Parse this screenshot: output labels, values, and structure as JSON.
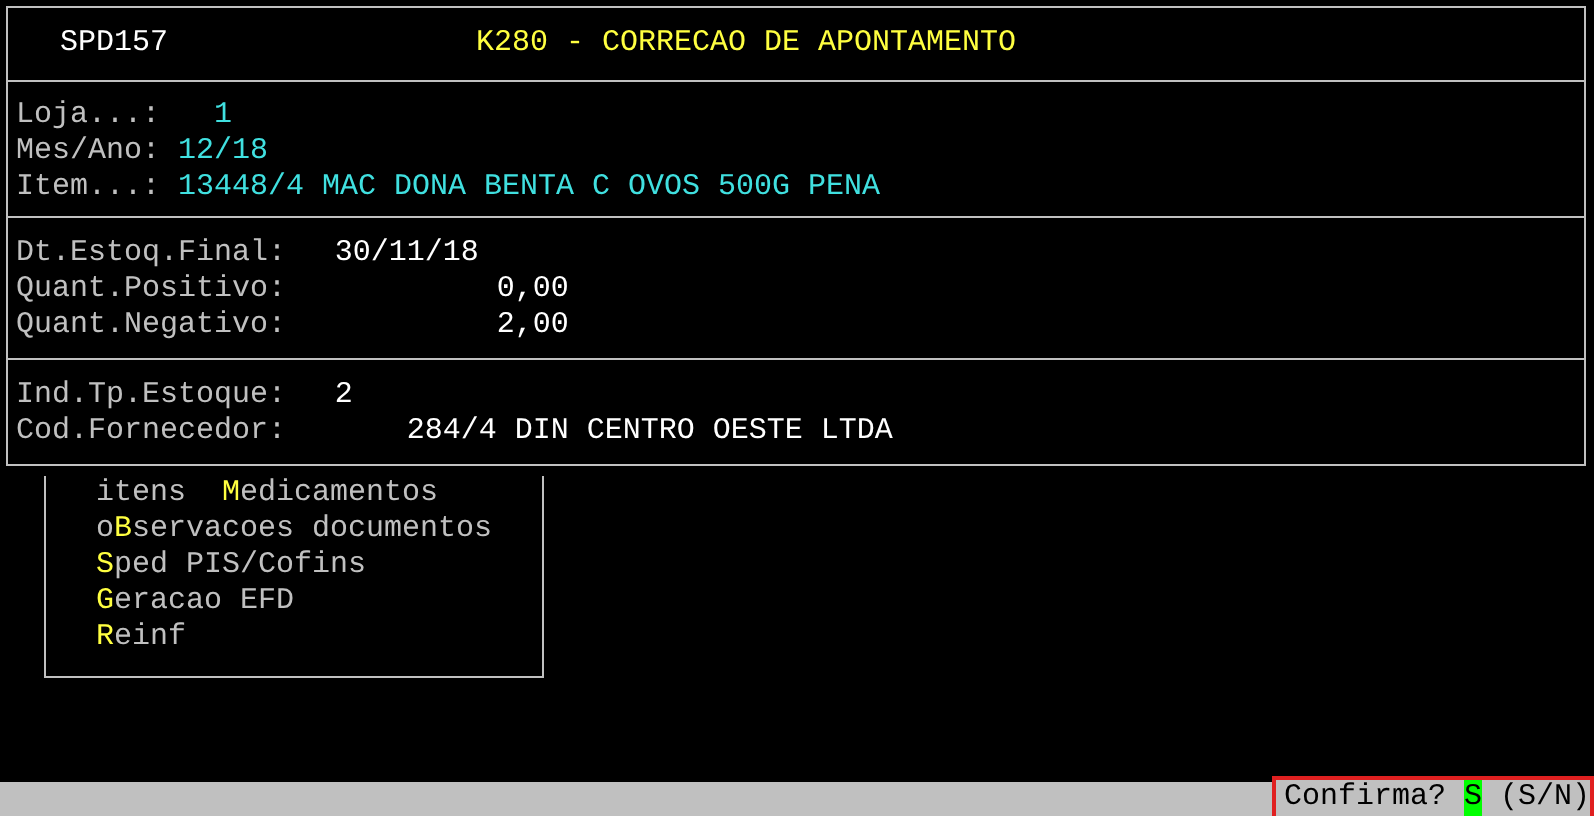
{
  "header": {
    "program": "SPD157",
    "title": "K280 - CORRECAO DE APONTAMENTO"
  },
  "sections": [
    {
      "fields": [
        {
          "label": "Loja...:",
          "value": "1",
          "kind": "code"
        },
        {
          "label": "Mes/Ano:",
          "value": "12/18",
          "kind": "text"
        },
        {
          "label": "Item...:",
          "value": "13448/4 MAC DONA BENTA C OVOS 500G PENA",
          "kind": "text"
        }
      ]
    },
    {
      "fields": [
        {
          "label": "Dt.Estoq.Final:",
          "value": "30/11/18",
          "kind": "text"
        },
        {
          "label": "Quant.Positivo:",
          "value": "0,00",
          "kind": "number"
        },
        {
          "label": "Quant.Negativo:",
          "value": "2,00",
          "kind": "number"
        }
      ]
    },
    {
      "fields": [
        {
          "label": "Ind.Tp.Estoque:",
          "value": "2",
          "kind": "text"
        },
        {
          "label": "Cod.Fornecedor:",
          "value": "284/4 DIN CENTRO OESTE LTDA",
          "kind": "code"
        }
      ]
    }
  ],
  "menu": [
    {
      "before": "itens  ",
      "hotkey": "M",
      "after": "edicamentos"
    },
    {
      "before": "o",
      "hotkey": "B",
      "after": "servacoes documentos"
    },
    {
      "hotkey": "S",
      "after": "ped PIS/Cofins"
    },
    {
      "hotkey": "G",
      "after": "eracao EFD"
    },
    {
      "hotkey": "R",
      "after": "einf"
    }
  ],
  "status_bar": {
    "prompt": "Confirma?",
    "answer": "S",
    "options": "(S/N)"
  }
}
